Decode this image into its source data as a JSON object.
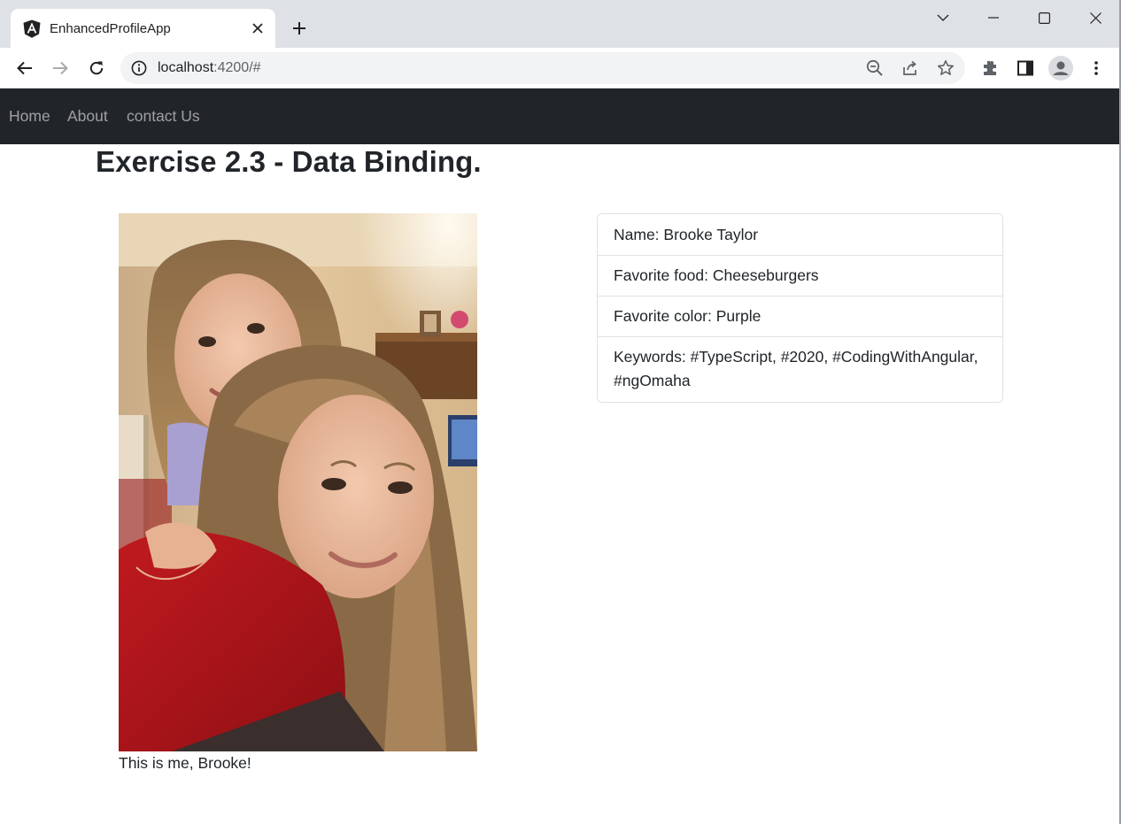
{
  "browser": {
    "tab_title": "EnhancedProfileApp",
    "url_host": "localhost",
    "url_rest": ":4200/#",
    "icons": [
      "angular-icon",
      "close-icon",
      "plus-icon",
      "chevron-down-icon",
      "minimize-icon",
      "maximize-icon",
      "close-window-icon",
      "back-arrow-icon",
      "forward-arrow-icon",
      "reload-icon",
      "info-icon",
      "zoom-out-icon",
      "share-icon",
      "star-icon",
      "extensions-icon",
      "side-panel-icon",
      "profile-icon",
      "kebab-menu-icon"
    ]
  },
  "nav": {
    "links": [
      "Home",
      "About",
      "contact Us"
    ]
  },
  "page": {
    "title": "Exercise 2.3 - Data Binding.",
    "caption": "This is me, Brooke!"
  },
  "profile": {
    "items": [
      "Name: Brooke Taylor",
      "Favorite food: Cheeseburgers",
      "Favorite color: Purple",
      "Keywords: #TypeScript, #2020, #CodingWithAngular, #ngOmaha"
    ]
  },
  "colors": {
    "navbar_bg": "#212529",
    "nav_link": "rgba(255,255,255,0.55)",
    "titlebar_bg": "#dee1e6",
    "text": "#212529"
  }
}
